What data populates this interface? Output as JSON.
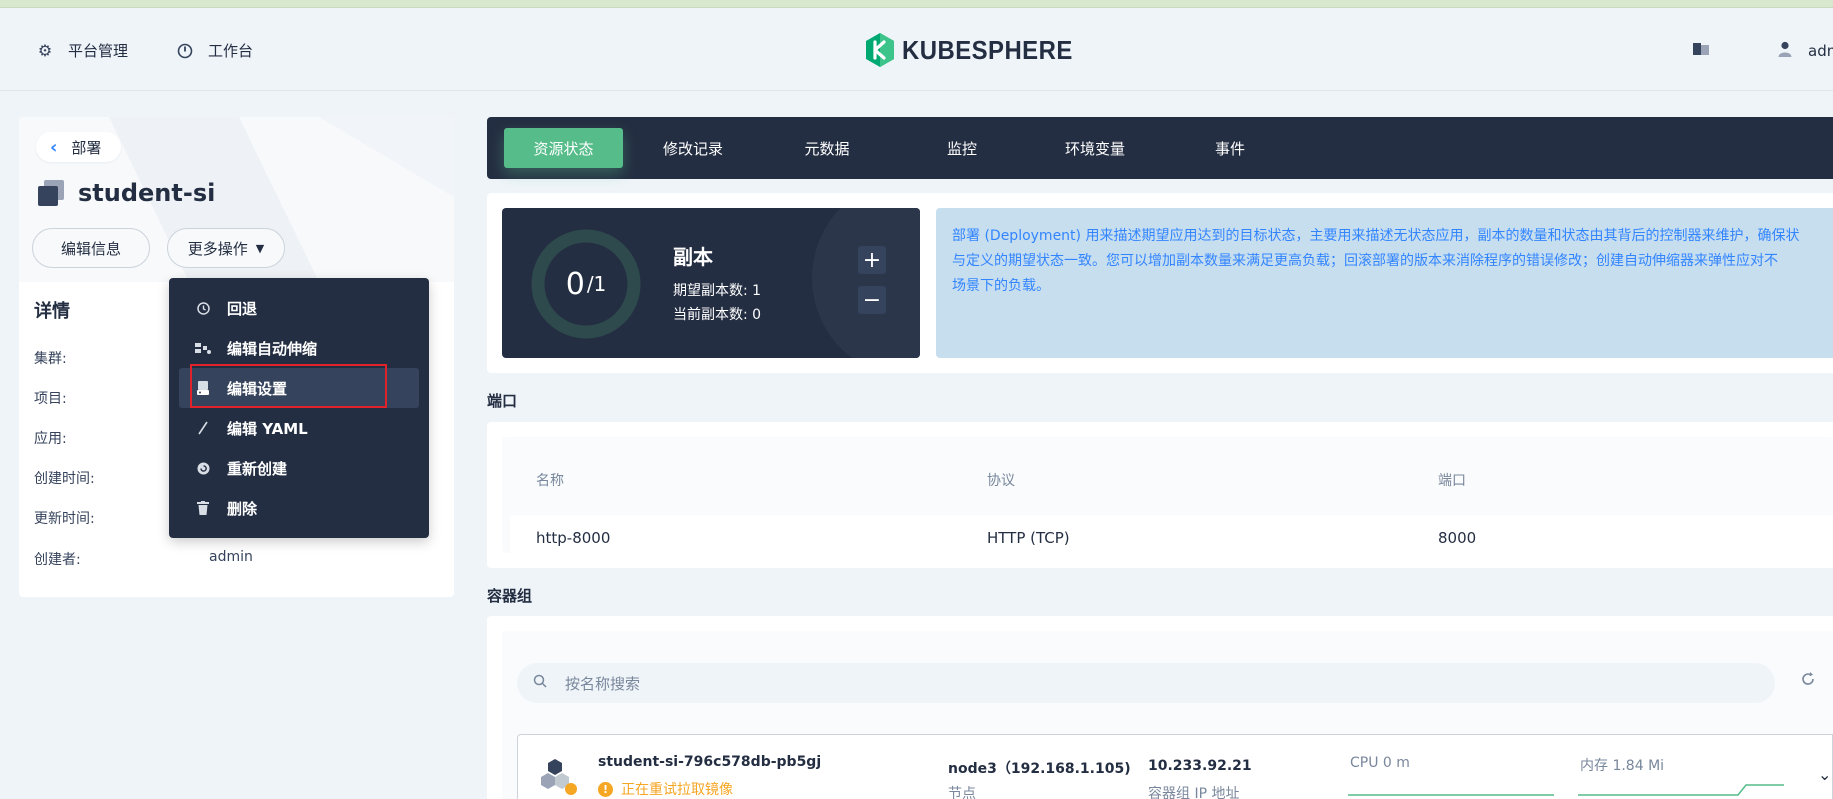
{
  "header": {
    "nav": [
      {
        "label": "平台管理",
        "icon": "gear-icon"
      },
      {
        "label": "工作台",
        "icon": "dashboard-icon"
      }
    ],
    "logo_text": "KUBESPHERE",
    "user": "adm"
  },
  "left": {
    "back_label": "部署",
    "deployment_name": "student-si",
    "edit_info_label": "编辑信息",
    "more_actions_label": "更多操作",
    "details_title": "详情",
    "details": [
      {
        "label": "集群:",
        "value": ""
      },
      {
        "label": "项目:",
        "value": ""
      },
      {
        "label": "应用:",
        "value": ""
      },
      {
        "label": "创建时间:",
        "value": ""
      },
      {
        "label": "更新时间:",
        "value": ""
      },
      {
        "label": "创建者:",
        "value": "admin"
      }
    ]
  },
  "dropdown": {
    "items": [
      {
        "label": "回退",
        "icon": "history-icon"
      },
      {
        "label": "编辑自动伸缩",
        "icon": "autoscale-icon"
      },
      {
        "label": "编辑设置",
        "icon": "storage-icon"
      },
      {
        "label": "编辑 YAML",
        "icon": "pen-icon"
      },
      {
        "label": "重新创建",
        "icon": "restart-icon"
      },
      {
        "label": "删除",
        "icon": "trash-icon"
      }
    ],
    "active_index": 2
  },
  "tabs": [
    "资源状态",
    "修改记录",
    "元数据",
    "监控",
    "环境变量",
    "事件"
  ],
  "replica": {
    "current": "0",
    "desired": "/1",
    "title": "副本",
    "desired_line": "期望副本数: 1",
    "current_line": "当前副本数: 0",
    "plus": "+",
    "minus": "−"
  },
  "info_lines": [
    "部署 (Deployment) 用来描述期望应用达到的目标状态，主要用来描述无状态应用，副本的数量和状态由其背后的控制器来维护，确保状",
    "与定义的期望状态一致。您可以增加副本数量来满足更高负载；回滚部署的版本来消除程序的错误修改；创建自动伸缩器来弹性应对不",
    "场景下的负载。"
  ],
  "ports": {
    "section_title": "端口",
    "headers": [
      "名称",
      "协议",
      "端口"
    ],
    "row": [
      "http-8000",
      "HTTP (TCP)",
      "8000"
    ]
  },
  "pods": {
    "section_title": "容器组",
    "search_placeholder": "按名称搜索",
    "pod": {
      "name": "student-si-796c578db-pb5gj",
      "status": "正在重试拉取镜像",
      "node": "node3（192.168.1.105)",
      "node_label": "节点",
      "ip": "10.233.92.21",
      "ip_label": "容器组 IP 地址",
      "cpu": "CPU 0 m",
      "memory": "内存 1.84 Mi"
    }
  },
  "colors": {
    "accent_green": "#55bc8a",
    "dark": "#242e42",
    "highlight_red": "#e0222a",
    "warning": "#f5a623"
  }
}
